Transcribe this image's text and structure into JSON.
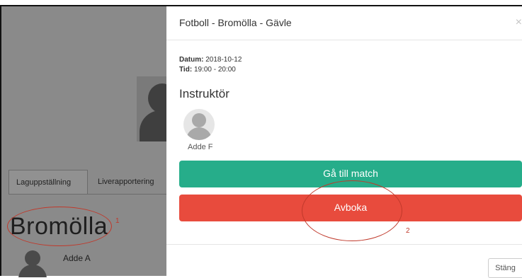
{
  "background": {
    "tabs": [
      "Laguppställning",
      "Liverapportering"
    ],
    "team_name": "Bromölla",
    "player_name": "Adde A"
  },
  "annotations": {
    "marker_1": "1",
    "marker_2": "2",
    "color": "#c0392b"
  },
  "modal": {
    "title": "Fotboll - Bromölla - Gävle",
    "close_icon": "×",
    "date_label": "Datum:",
    "date_value": "2018-10-12",
    "time_label": "Tid:",
    "time_value": "19:00 - 20:00",
    "section_title": "Instruktör",
    "instructor_name": "Adde F",
    "primary_button": "Gå till match",
    "danger_button": "Avboka",
    "close_button": "Stäng"
  },
  "colors": {
    "primary": "#26ad8a",
    "danger": "#e84b3d",
    "overlay": "#8a8a8a"
  }
}
